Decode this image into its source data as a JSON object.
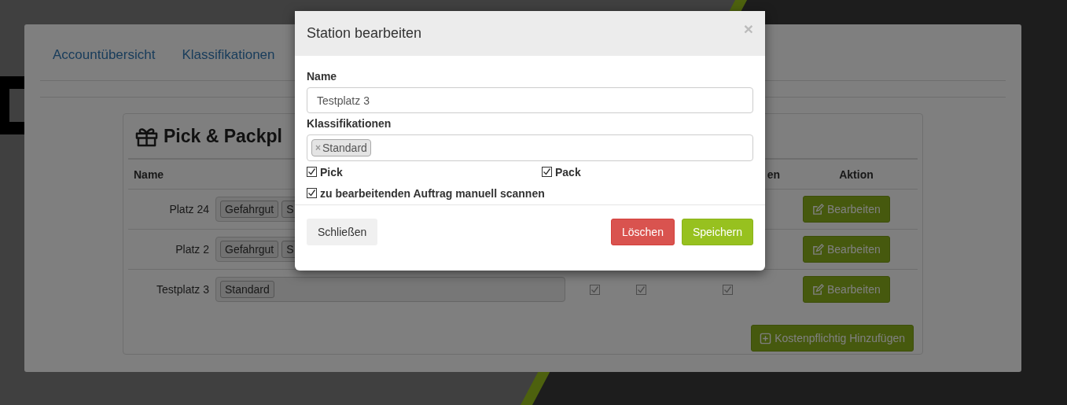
{
  "nav": [
    {
      "label": "Accountübersicht"
    },
    {
      "label": "Klassifikationen"
    }
  ],
  "card": {
    "title": "Pick & Packpl",
    "columns": [
      {
        "kind": "name",
        "label": "Name"
      },
      {
        "kind": "tags"
      },
      {
        "kind": "check"
      },
      {
        "kind": "check"
      },
      {
        "kind": "check",
        "label": "en"
      },
      {
        "kind": "action",
        "label": "Aktion"
      }
    ],
    "rows": [
      {
        "name": "Platz 24",
        "tags": [
          "Gefahrgut",
          "S"
        ],
        "action": "Bearbeiten"
      },
      {
        "name": "Platz 2",
        "tags": [
          "Gefahrgut",
          "S"
        ],
        "action": "Bearbeiten"
      },
      {
        "name": "Testplatz 3",
        "tags": [
          "Standard"
        ],
        "checks": [
          {
            "checked": true
          },
          {
            "checked": true
          },
          {
            "checked": true
          }
        ],
        "action": "Bearbeiten"
      }
    ],
    "add_button": "Kostenpflichtig Hinzufügen"
  },
  "modal": {
    "title": "Station bearbeiten",
    "close": "×",
    "name_label": "Name",
    "name_value": "Testplatz 3",
    "class_label": "Klassifikationen",
    "class_tags": [
      {
        "remove": "×",
        "label": "Standard"
      }
    ],
    "options": [
      {
        "label": "Pick",
        "checked": true
      },
      {
        "label": "Pack",
        "checked": true
      },
      {
        "label": "zu bearbeitenden Auftrag manuell scannen",
        "checked": true
      }
    ],
    "buttons": [
      {
        "kind": "default",
        "label": "Schließen"
      },
      {
        "kind": "danger",
        "label": "Löschen"
      },
      {
        "kind": "primary",
        "label": "Speichern"
      }
    ]
  }
}
